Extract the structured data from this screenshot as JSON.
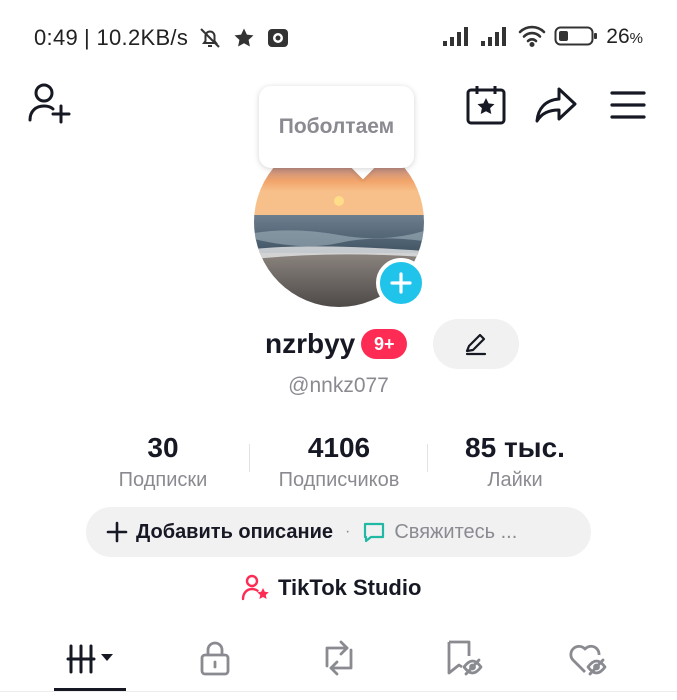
{
  "status_bar": {
    "time": "0:49",
    "network_speed": "| 10.2KB/s",
    "battery_percent": "26",
    "battery_unit": "%",
    "icons": [
      "bell-off-icon",
      "star-icon",
      "camera-app-icon",
      "signal-icon",
      "signal-icon",
      "wifi-icon",
      "battery-icon"
    ]
  },
  "top_bar": {
    "icons": [
      "add-friend-icon",
      "calendar-star-icon",
      "share-icon",
      "menu-icon"
    ]
  },
  "tooltip": {
    "text": "Поболтаем"
  },
  "profile": {
    "username": "nzrbyy",
    "notification_badge": "9+",
    "handle": "@nnkz077"
  },
  "stats": [
    {
      "value": "30",
      "label": "Подписки"
    },
    {
      "value": "4106",
      "label": "Подписчиков"
    },
    {
      "value": "85 тыс.",
      "label": "Лайки"
    }
  ],
  "bio": {
    "add_description": "Добавить описание",
    "separator": "·",
    "contact": "Свяжитесь ..."
  },
  "studio": {
    "label": "TikTok Studio"
  },
  "tabs": [
    {
      "name": "videos-tab",
      "icon": "grid-icon",
      "active": true
    },
    {
      "name": "private-tab",
      "icon": "lock-icon",
      "active": false
    },
    {
      "name": "reposts-tab",
      "icon": "repost-icon",
      "active": false
    },
    {
      "name": "favorites-tab",
      "icon": "bookmark-hidden-icon",
      "active": false
    },
    {
      "name": "liked-tab",
      "icon": "heart-hidden-icon",
      "active": false
    }
  ],
  "colors": {
    "accent_pink": "#fe2c55",
    "accent_cyan": "#20c4eb",
    "contact_green": "#21b8a4",
    "studio_pink": "#fe2c55"
  }
}
